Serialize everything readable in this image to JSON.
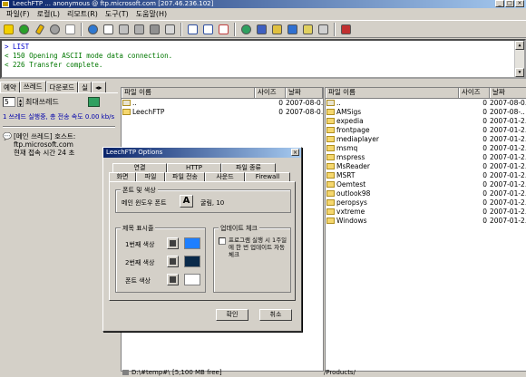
{
  "window": {
    "title": "LeechFTP  ... anonymous @ ftp.microsoft.com  [207.46.236.102]",
    "controls": [
      "_",
      "□",
      "×"
    ]
  },
  "menubar": [
    "파일(F)",
    "로컬(L)",
    "리모트(R)",
    "도구(T)",
    "도움말(H)"
  ],
  "log": [
    {
      "text": "> LIST",
      "kind": "cmd"
    },
    {
      "text": "< 150 Opening ASCII mode data connection.",
      "kind": "resp"
    },
    {
      "text": "< 226 Transfer complete.",
      "kind": "resp"
    }
  ],
  "left_panel": {
    "tabs": [
      "예약",
      "쓰레드",
      "다운로드",
      "실"
    ],
    "thread_count": "5",
    "max_thread_label": "최대쓰레드",
    "status": "1 쓰레드 실행중, 총 전송 속도 0.00 kb/s",
    "thread_info": [
      "[메인 쓰레드] 호스트:",
      "ftp.microsoft.com",
      "현재 접속 시간 24 초"
    ]
  },
  "local_pane": {
    "headers": [
      "파일 이름",
      "사이즈",
      "날짜"
    ],
    "rows": [
      {
        "name": "..",
        "size": "0",
        "date": "2007-08-0.",
        "up": true
      },
      {
        "name": "LeechFTP",
        "size": "0",
        "date": "2007-08-0.",
        "up": false
      }
    ],
    "path": "D:\\#temp#\\",
    "free": "[5,100 MB free]"
  },
  "remote_pane": {
    "headers": [
      "파일 이름",
      "사이즈",
      "날짜"
    ],
    "rows": [
      {
        "name": "..",
        "size": "0",
        "date": "2007-08-0.",
        "up": true
      },
      {
        "name": "AMSigs",
        "size": "0",
        "date": "2007-08-..",
        "up": false
      },
      {
        "name": "expedia",
        "size": "0",
        "date": "2007-01-2..",
        "up": false
      },
      {
        "name": "frontpage",
        "size": "0",
        "date": "2007-01-2..",
        "up": false
      },
      {
        "name": "mediaplayer",
        "size": "0",
        "date": "2007-01-2..",
        "up": false
      },
      {
        "name": "msmq",
        "size": "0",
        "date": "2007-01-2..",
        "up": false
      },
      {
        "name": "mspress",
        "size": "0",
        "date": "2007-01-2..",
        "up": false
      },
      {
        "name": "MsReader",
        "size": "0",
        "date": "2007-01-2..",
        "up": false
      },
      {
        "name": "MSRT",
        "size": "0",
        "date": "2007-01-2..",
        "up": false
      },
      {
        "name": "Oemtest",
        "size": "0",
        "date": "2007-01-2..",
        "up": false
      },
      {
        "name": "outlook98",
        "size": "0",
        "date": "2007-01-2..",
        "up": false
      },
      {
        "name": "peropsys",
        "size": "0",
        "date": "2007-01-2..",
        "up": false
      },
      {
        "name": "vxtreme",
        "size": "0",
        "date": "2007-01-2..",
        "up": false
      },
      {
        "name": "Windows",
        "size": "0",
        "date": "2007-01-2..",
        "up": false
      }
    ],
    "path": "/Products/"
  },
  "dialog": {
    "title": "LeechFTP Options",
    "tabs_row1": [
      "연결",
      "HTTP",
      "파일 종류"
    ],
    "tabs_row2": [
      "화면",
      "파일",
      "파일 전송",
      "사운드",
      "Firewall"
    ],
    "font_group": "폰트 및 색상",
    "font_label": "메인 윈도우 폰트",
    "font_button": "A",
    "font_value": "굴림, 10",
    "title_group": "제목 표시줄",
    "color1": "1번째 색상",
    "color2": "2번째 색상",
    "font_color": "폰트 색상",
    "colors": {
      "c1": "#1e7fff",
      "c2": "#0a2a4a",
      "font": "#ffffff"
    },
    "update_group": "업데이트 체크",
    "update_check": "프로그램 실행 시 1주일에 한 번 업데이트 자동 체크",
    "ok": "확인",
    "cancel": "취소"
  },
  "colors": {
    "titlebar": "#0a246a",
    "log_cmd": "#0000cc",
    "log_resp": "#007700",
    "folder": "#f5d76e"
  },
  "toolbar_icons": [
    "lightning-icon",
    "go-icon",
    "pencil-icon",
    "stop-icon",
    "disconnect-icon",
    "globe-icon",
    "document-icon",
    "local-upload-icon",
    "trash-icon",
    "folder-icon",
    "rename-icon",
    "view-icon",
    "view2-icon",
    "view3-icon",
    "sync-icon",
    "sort-icon",
    "tree-icon",
    "filter-icon",
    "queue-icon",
    "bookmark-icon",
    "exit-icon"
  ]
}
